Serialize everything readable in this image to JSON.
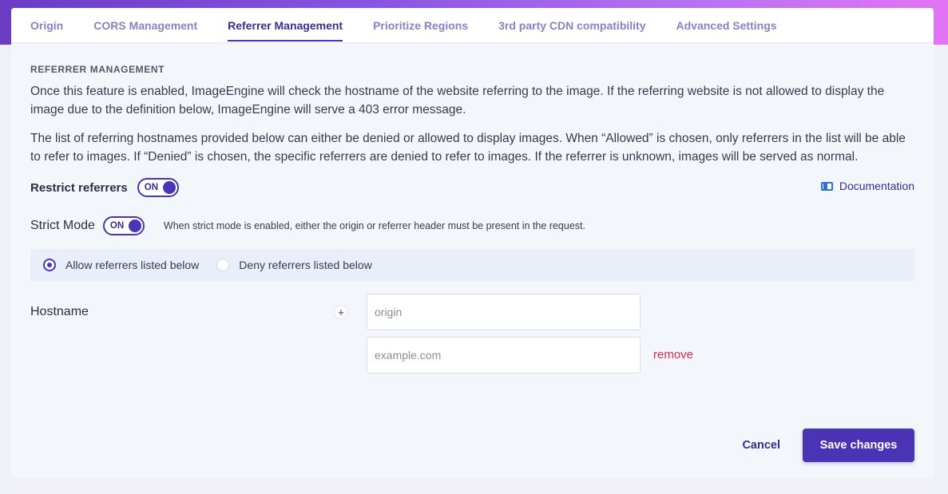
{
  "tabs": [
    {
      "label": "Origin",
      "active": false
    },
    {
      "label": "CORS Management",
      "active": false
    },
    {
      "label": "Referrer Management",
      "active": true
    },
    {
      "label": "Prioritize Regions",
      "active": false
    },
    {
      "label": "3rd party CDN compatibility",
      "active": false
    },
    {
      "label": "Advanced Settings",
      "active": false
    }
  ],
  "section": {
    "title": "REFERRER MANAGEMENT",
    "para1": "Once this feature is enabled, ImageEngine will check the hostname of the website referring to the image. If the referring website is not allowed to display the image due to the definition below, ImageEngine will serve a 403 error message.",
    "para2": "The list of referring hostnames provided below can either be denied or allowed to display images. When “Allowed” is chosen, only referrers in the list will be able to refer to images. If “Denied” is chosen, the specific referrers are denied to refer to images. If the referrer is unknown, images will be served as normal."
  },
  "restrict": {
    "label": "Restrict referrers",
    "toggle": "ON"
  },
  "documentation": {
    "label": "Documentation",
    "icon": "book-icon"
  },
  "strict": {
    "label": "Strict Mode",
    "toggle": "ON",
    "hint": "When strict mode is enabled, either the origin or referrer header must be present in the request."
  },
  "mode": {
    "options": [
      "Allow referrers listed below",
      "Deny referrers listed below"
    ],
    "selected": "Allow referrers listed below"
  },
  "hostname": {
    "label": "Hostname",
    "add_icon": "plus-icon",
    "fields": [
      {
        "value": "",
        "placeholder": "origin"
      },
      {
        "value": "",
        "placeholder": "example.com"
      }
    ],
    "remove_label": "remove"
  },
  "actions": {
    "cancel": "Cancel",
    "save": "Save changes"
  },
  "colors": {
    "accent": "#4a35b8",
    "danger": "#e0284e",
    "tab_inactive": "#8a80c4"
  }
}
